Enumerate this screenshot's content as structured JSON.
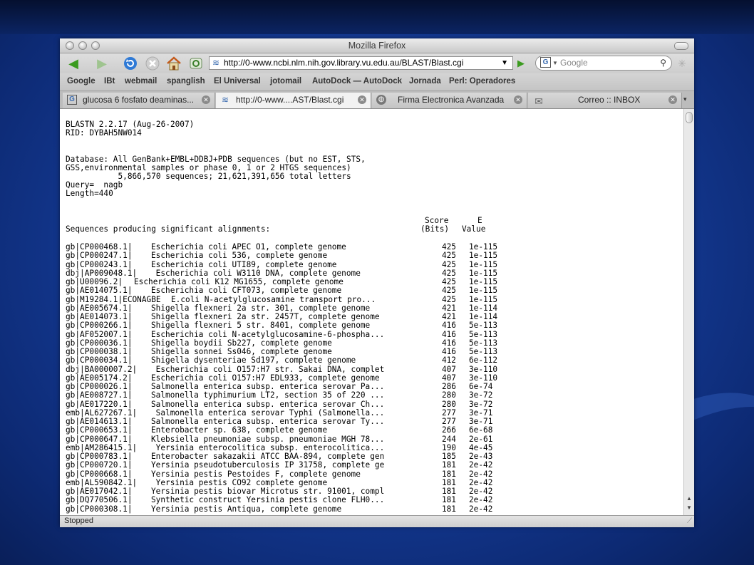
{
  "window": {
    "title": "Mozilla Firefox"
  },
  "nav": {
    "back_icon": "back-arrow-icon",
    "forward_icon": "forward-arrow-icon",
    "url": "http://0-www.ncbi.nlm.nih.gov.library.vu.edu.au/BLAST/Blast.cgi",
    "search_placeholder": "Google"
  },
  "bookmarks": [
    "Google",
    "IBt",
    "webmail",
    "spanglish",
    "El Universal",
    "jotomail",
    "AutoDock — AutoDock",
    "Jornada",
    "Perl: Operadores"
  ],
  "tabs": [
    {
      "label": "glucosa 6 fosfato deaminas...",
      "icon": "google-icon"
    },
    {
      "label": "http://0-www....AST/Blast.cgi",
      "icon": "ncbi-icon"
    },
    {
      "label": "Firma Electronica Avanzada",
      "icon": "globe-icon"
    },
    {
      "label": "Correo :: INBOX",
      "icon": "mail-icon"
    }
  ],
  "blast": {
    "version": "BLASTN 2.2.17 (Aug-26-2007)",
    "rid": "RID: DYBAH5NW014",
    "database_1": "Database: All GenBank+EMBL+DDBJ+PDB sequences (but no EST, STS,",
    "database_2": "GSS,environmental samples or phase 0, 1 or 2 HTGS sequences)",
    "database_3": "           5,866,570 sequences; 21,621,391,656 total letters",
    "query": "Query=  nagb",
    "length": "Length=440",
    "col_score_1": "Score",
    "col_e_1": "E",
    "col_header": "Sequences producing significant alignments:",
    "col_score_2": "(Bits)",
    "col_e_2": "Value"
  },
  "hits": [
    {
      "id": "gb|CP000468.1|",
      "desc": "Escherichia coli APEC O1, complete genome",
      "score": "425",
      "e": "1e-115"
    },
    {
      "id": "gb|CP000247.1|",
      "desc": "Escherichia coli 536, complete genome",
      "score": "425",
      "e": "1e-115"
    },
    {
      "id": "gb|CP000243.1|",
      "desc": "Escherichia coli UTI89, complete genome",
      "score": "425",
      "e": "1e-115"
    },
    {
      "id": "dbj|AP009048.1|",
      "desc": " Escherichia coli W3110 DNA, complete genome",
      "score": "425",
      "e": "1e-115"
    },
    {
      "id": "gb|U00096.2|",
      "desc": "Escherichia coli K12 MG1655, complete genome",
      "score": "425",
      "e": "1e-115",
      "shift": true
    },
    {
      "id": "gb|AE014075.1|",
      "desc": "Escherichia coli CFT073, complete genome",
      "score": "425",
      "e": "1e-115"
    },
    {
      "id": "gb|M19284.1|ECONAGBE",
      "desc": "E.coli N-acetylglucosamine transport pro...",
      "score": "425",
      "e": "1e-115",
      "long": true
    },
    {
      "id": "gb|AE005674.1|",
      "desc": "Shigella flexneri 2a str. 301, complete genome",
      "score": "421",
      "e": "1e-114"
    },
    {
      "id": "gb|AE014073.1|",
      "desc": "Shigella flexneri 2a str. 2457T, complete genome",
      "score": "421",
      "e": "1e-114"
    },
    {
      "id": "gb|CP000266.1|",
      "desc": "Shigella flexneri 5 str. 8401, complete genome",
      "score": "416",
      "e": "5e-113"
    },
    {
      "id": "gb|AF052007.1|",
      "desc": "Escherichia coli N-acetylglucosamine-6-phospha...",
      "score": "416",
      "e": "5e-113"
    },
    {
      "id": "gb|CP000036.1|",
      "desc": "Shigella boydii Sb227, complete genome",
      "score": "416",
      "e": "5e-113"
    },
    {
      "id": "gb|CP000038.1|",
      "desc": "Shigella sonnei Ss046, complete genome",
      "score": "416",
      "e": "5e-113"
    },
    {
      "id": "gb|CP000034.1|",
      "desc": "Shigella dysenteriae Sd197, complete genome",
      "score": "412",
      "e": "6e-112"
    },
    {
      "id": "dbj|BA000007.2|",
      "desc": " Escherichia coli O157:H7 str. Sakai DNA, complet",
      "score": "407",
      "e": "3e-110"
    },
    {
      "id": "gb|AE005174.2|",
      "desc": "Escherichia coli O157:H7 EDL933, complete genome",
      "score": "407",
      "e": "3e-110"
    },
    {
      "id": "gb|CP000026.1|",
      "desc": "Salmonella enterica subsp. enterica serovar Pa...",
      "score": "286",
      "e": "6e-74"
    },
    {
      "id": "gb|AE008727.1|",
      "desc": "Salmonella typhimurium LT2, section 35 of 220 ...",
      "score": "280",
      "e": "3e-72"
    },
    {
      "id": "gb|AE017220.1|",
      "desc": "Salmonella enterica subsp. enterica serovar Ch...",
      "score": "280",
      "e": "3e-72"
    },
    {
      "id": "emb|AL627267.1|",
      "desc": " Salmonella enterica serovar Typhi (Salmonella...",
      "score": "277",
      "e": "3e-71"
    },
    {
      "id": "gb|AE014613.1|",
      "desc": "Salmonella enterica subsp. enterica serovar Ty...",
      "score": "277",
      "e": "3e-71"
    },
    {
      "id": "gb|CP000653.1|",
      "desc": "Enterobacter sp. 638, complete genome",
      "score": "266",
      "e": "6e-68"
    },
    {
      "id": "gb|CP000647.1|",
      "desc": "Klebsiella pneumoniae subsp. pneumoniae MGH 78...",
      "score": "244",
      "e": "2e-61"
    },
    {
      "id": "emb|AM286415.1|",
      "desc": " Yersinia enterocolitica subsp. enterocolitica...",
      "score": "190",
      "e": "4e-45"
    },
    {
      "id": "gb|CP000783.1|",
      "desc": "Enterobacter sakazakii ATCC BAA-894, complete gen",
      "score": "185",
      "e": "2e-43"
    },
    {
      "id": "gb|CP000720.1|",
      "desc": "Yersinia pseudotuberculosis IP 31758, complete ge",
      "score": "181",
      "e": "2e-42"
    },
    {
      "id": "gb|CP000668.1|",
      "desc": "Yersinia pestis Pestoides F, complete genome",
      "score": "181",
      "e": "2e-42"
    },
    {
      "id": "emb|AL590842.1|",
      "desc": " Yersinia pestis CO92 complete genome",
      "score": "181",
      "e": "2e-42"
    },
    {
      "id": "gb|AE017042.1|",
      "desc": "Yersinia pestis biovar Microtus str. 91001, compl",
      "score": "181",
      "e": "2e-42"
    },
    {
      "id": "gb|DQ770506.1|",
      "desc": "Synthetic construct Yersinia pestis clone FLH0...",
      "score": "181",
      "e": "2e-42"
    },
    {
      "id": "gb|CP000308.1|",
      "desc": "Yersinia pestis Antiqua, complete genome",
      "score": "181",
      "e": "2e-42"
    }
  ],
  "status": "Stopped"
}
